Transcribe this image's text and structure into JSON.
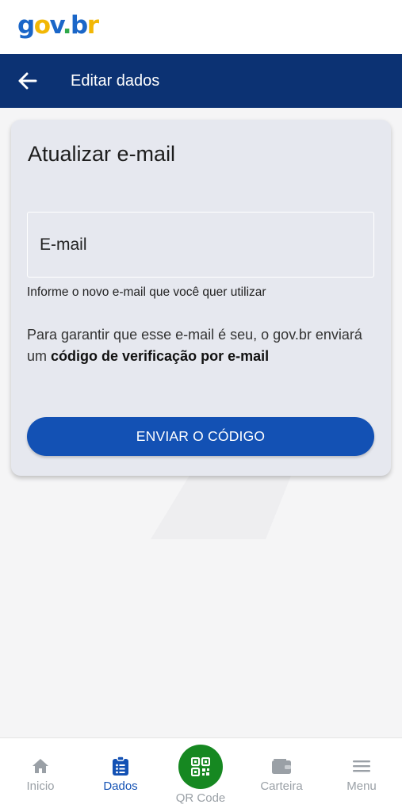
{
  "brand": {
    "logo_parts": [
      "g",
      "o",
      "v",
      ".",
      "b",
      "r"
    ],
    "colors": {
      "blue": "#1a66c8",
      "yellow": "#f2b705",
      "green": "#2ea84a"
    }
  },
  "header": {
    "title": "Editar dados",
    "back_icon": "arrow-left-icon",
    "background": "#0c3273"
  },
  "card": {
    "title": "Atualizar e-mail",
    "email_field": {
      "placeholder": "E-mail",
      "value": ""
    },
    "helper_text": "Informe o novo e-mail que você quer utilizar",
    "info_prefix": "Para garantir que esse e-mail é seu, o gov.br enviará um ",
    "info_bold": "código de verificação por e-mail",
    "submit_label": "ENVIAR O CÓDIGO",
    "accent": "#1351b4"
  },
  "bottom_nav": {
    "items": [
      {
        "label": "Inicio",
        "icon": "home-icon",
        "active": false
      },
      {
        "label": "Dados",
        "icon": "clipboard-list-icon",
        "active": true
      },
      {
        "label": "QR Code",
        "icon": "qr-code-icon",
        "active": false
      },
      {
        "label": "Carteira",
        "icon": "wallet-icon",
        "active": false
      },
      {
        "label": "Menu",
        "icon": "hamburger-menu-icon",
        "active": false
      }
    ],
    "active_color": "#1351b4",
    "qr_color": "#168821"
  }
}
